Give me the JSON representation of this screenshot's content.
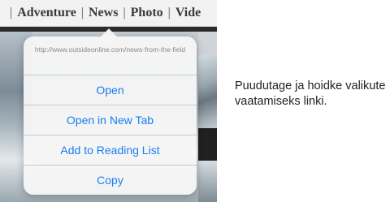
{
  "nav": {
    "separator": "|",
    "items": [
      "Adventure",
      "News",
      "Photo",
      "Vide"
    ]
  },
  "popover": {
    "url": "http://www.outsideonline.com/news-from-the-field",
    "actions": [
      "Open",
      "Open in New Tab",
      "Add to Reading List",
      "Copy"
    ]
  },
  "caption": "Puudutage ja hoidke valikute vaatamiseks linki.",
  "colors": {
    "action_text": "#1a7ef0",
    "url_text": "#8a8a8a",
    "caption_text": "#222222"
  }
}
